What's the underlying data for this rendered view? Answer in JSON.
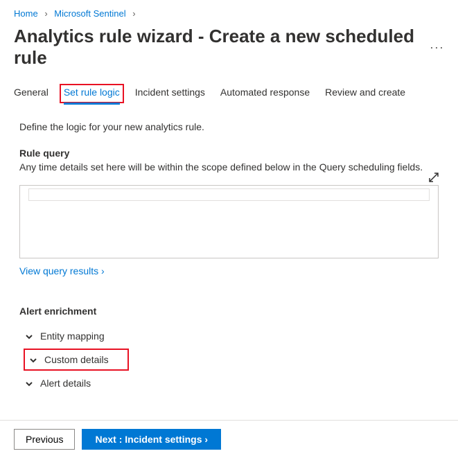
{
  "breadcrumb": {
    "home": "Home",
    "sentinel": "Microsoft Sentinel"
  },
  "page": {
    "title": "Analytics rule wizard - Create a new scheduled rule",
    "more": "···"
  },
  "tabs": {
    "general": "General",
    "set_rule_logic": "Set rule logic",
    "incident_settings": "Incident settings",
    "automated_response": "Automated response",
    "review_create": "Review and create"
  },
  "body": {
    "intro": "Define the logic for your new analytics rule.",
    "rule_query_heading": "Rule query",
    "rule_query_sub": "Any time details set here will be within the scope defined below in the Query scheduling fields.",
    "view_results": "View query results ›",
    "enrichment_heading": "Alert enrichment",
    "acc_entity": "Entity mapping",
    "acc_custom": "Custom details",
    "acc_alert": "Alert details"
  },
  "footer": {
    "previous": "Previous",
    "next": "Next : Incident settings ›"
  }
}
